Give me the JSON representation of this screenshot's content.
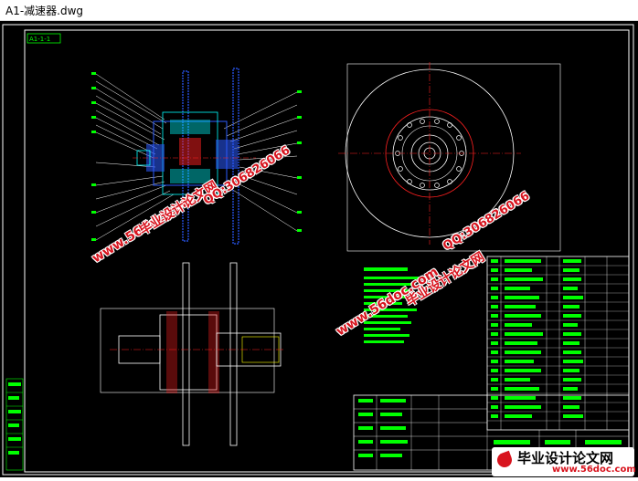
{
  "window": {
    "title": "A1-减速器.dwg"
  },
  "drawing": {
    "frame_tag": "A1-1-1",
    "tech_notes_heading": "技术要求",
    "colors": {
      "frame": "#ffffff",
      "green": "#00ff00",
      "blue": "#2b5bff",
      "red": "#ff2020",
      "cyan": "#00ffff",
      "yellow": "#ffff00"
    }
  },
  "watermarks": {
    "site1": "www.56doc.com",
    "brand1": "毕业设计论文网",
    "qq1": "QQ:306826066",
    "site2": "www.56doc.com",
    "brand2": "毕业设计论文网",
    "qq2": "QQ:306826066",
    "logo_main": "毕业设计论文网",
    "logo_url": "www.56doc.com"
  }
}
